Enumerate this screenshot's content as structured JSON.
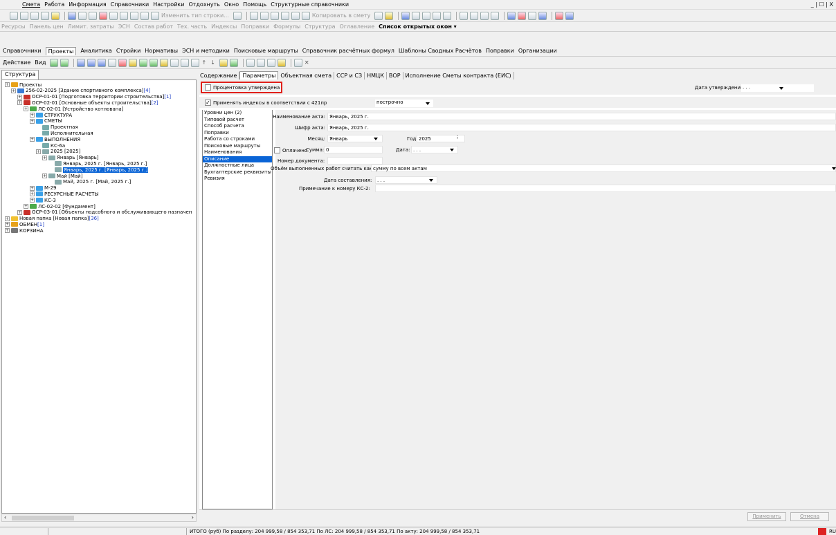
{
  "menu": [
    "Смета",
    "Работа",
    "Информация",
    "Справочники",
    "Настройки",
    "Отдохнуть",
    "Окно",
    "Помощь",
    "Структурные справочники"
  ],
  "win_controls": "_ | ☐ | Х",
  "tb1": {
    "change_type": "Изменить тип строки...",
    "copy_to_estimate": "Копировать в смету"
  },
  "tb2": [
    "Ресурсы",
    "Панель цен",
    "Лимит. затраты",
    "ЭСН",
    "Состав работ",
    "Тех. часть",
    "Индексы",
    "Поправки",
    "Формулы",
    "Структура",
    "Оглавление"
  ],
  "tb2_open": "Список открытых окон ▾",
  "tabs1": [
    "Справочники",
    "Проекты",
    "Аналитика",
    "Стройки",
    "Нормативы",
    "ЭСН и методики",
    "Поисковые маршруты",
    "Справочник расчётных формул",
    "Шаблоны Сводных Расчётов",
    "Поправки",
    "Организации"
  ],
  "tb4": {
    "action": "Действие",
    "view": "Вид"
  },
  "structure_tab": "Структура",
  "tree": [
    {
      "t": "Проекты",
      "d": 0,
      "ic": "projects"
    },
    {
      "t": "256-02-2025 [Здание спортивного комплекса]",
      "n": " [4]",
      "d": 1,
      "ic": "building"
    },
    {
      "t": "ОСР-01-01 [Подготовка территории строительства]",
      "n": " [1]",
      "d": 2,
      "ic": "osr"
    },
    {
      "t": "ОСР-02-01 [Основные объекты строительства]",
      "n": " [2]",
      "d": 2,
      "ic": "osr"
    },
    {
      "t": "ЛС-02-01 [Устройство котлована]",
      "d": 3,
      "ic": "ls"
    },
    {
      "t": "СТРУКТУРА",
      "d": 4,
      "ic": "folder-blue"
    },
    {
      "t": "СМЕТЫ",
      "d": 4,
      "ic": "folder-blue"
    },
    {
      "t": "Проектная",
      "d": 5,
      "ic": "doc"
    },
    {
      "t": "Исполнительная",
      "d": 5,
      "ic": "doc"
    },
    {
      "t": "ВЫПОЛНЕНИЯ",
      "d": 4,
      "ic": "folder-blue"
    },
    {
      "t": "КС-6а",
      "d": 5,
      "ic": "ks"
    },
    {
      "t": "2025 [2025]",
      "d": 5,
      "ic": "cal"
    },
    {
      "t": "Январь [Январь]",
      "d": 6,
      "ic": "cal"
    },
    {
      "t": "Январь, 2025 г. [Январь, 2025 г.]",
      "d": 7,
      "ic": "cal"
    },
    {
      "t": "Январь, 2025 г. [Январь, 2025 г.]",
      "d": 7,
      "ic": "cal",
      "sel": true
    },
    {
      "t": "Май [Май]",
      "d": 6,
      "ic": "cal"
    },
    {
      "t": "Май, 2025 г. [Май, 2025 г.]",
      "d": 7,
      "ic": "cal"
    },
    {
      "t": "М-29",
      "d": 4,
      "ic": "folder-blue"
    },
    {
      "t": "РЕСУРСНЫЕ РАСЧЕТЫ",
      "d": 4,
      "ic": "folder-blue"
    },
    {
      "t": "КС-3",
      "d": 4,
      "ic": "folder-blue"
    },
    {
      "t": "ЛС-02-02 [Фундамент]",
      "d": 3,
      "ic": "ls"
    },
    {
      "t": "ОСР-03-01 [Объекты подсобного и обслуживающего назначен",
      "d": 2,
      "ic": "osr"
    },
    {
      "t": "Новая папка [Новая папка]",
      "n": " [36]",
      "d": 0,
      "ic": "folder-yellow"
    },
    {
      "t": "ОБМЕН",
      "n": " [1]",
      "d": 0,
      "ic": "exchange"
    },
    {
      "t": "КОРЗИНА",
      "d": 0,
      "ic": "trash"
    }
  ],
  "tabs2": [
    "Содержание",
    "Параметры",
    "Объектная смета",
    "ССР и СЗ",
    "НМЦК",
    "ВОР",
    "Исполнение Сметы контракта (ЕИС)"
  ],
  "percent_approved": "Процентовка утверждена",
  "approval_date_label": "Дата утверждения:",
  "approval_date_value": ". . .",
  "apply_index_label": "Применять индексы в соответствии с 421пр",
  "apply_index_value": "построчно",
  "params_list": [
    "Уровни цен (2)",
    "Типовой расчет",
    "Способ расчета",
    "Поправки",
    "Работа со строками",
    "Поисковые маршруты",
    "Наименования",
    "Описание",
    "Должностные лица",
    "Бухгалтерские реквизиты",
    "Ревизия"
  ],
  "form": {
    "act_name_label": "Наименование акта:",
    "act_name": "Январь, 2025 г.",
    "act_code_label": "Шифр акта:",
    "act_code": "Январь, 2025 г.",
    "month_label": "Месяц:",
    "month": "Январь",
    "year_label": "Год:",
    "year": "2025",
    "paid_label": "Оплачено",
    "sum_label": "Сумма:",
    "sum": "0",
    "date_label": "Дата:",
    "date": ". . .",
    "doc_number_label": "Номер документа:",
    "volume_label": "Объём выполненных работ считать как:",
    "volume": "сумму по всем актам",
    "compose_date_label": "Дата составления:",
    "compose_date": ". . .",
    "note_label": "Примечание к номеру КС-2:"
  },
  "apply_btn": "Применить",
  "cancel_btn": "Отмена",
  "status": "ИТОГО (руб) По разделу: 204 999,58 / 854 353,71    По ЛС: 204 999,58 / 854 353,71    По акту: 204 999,58 / 854 353,71",
  "lang": "RU"
}
